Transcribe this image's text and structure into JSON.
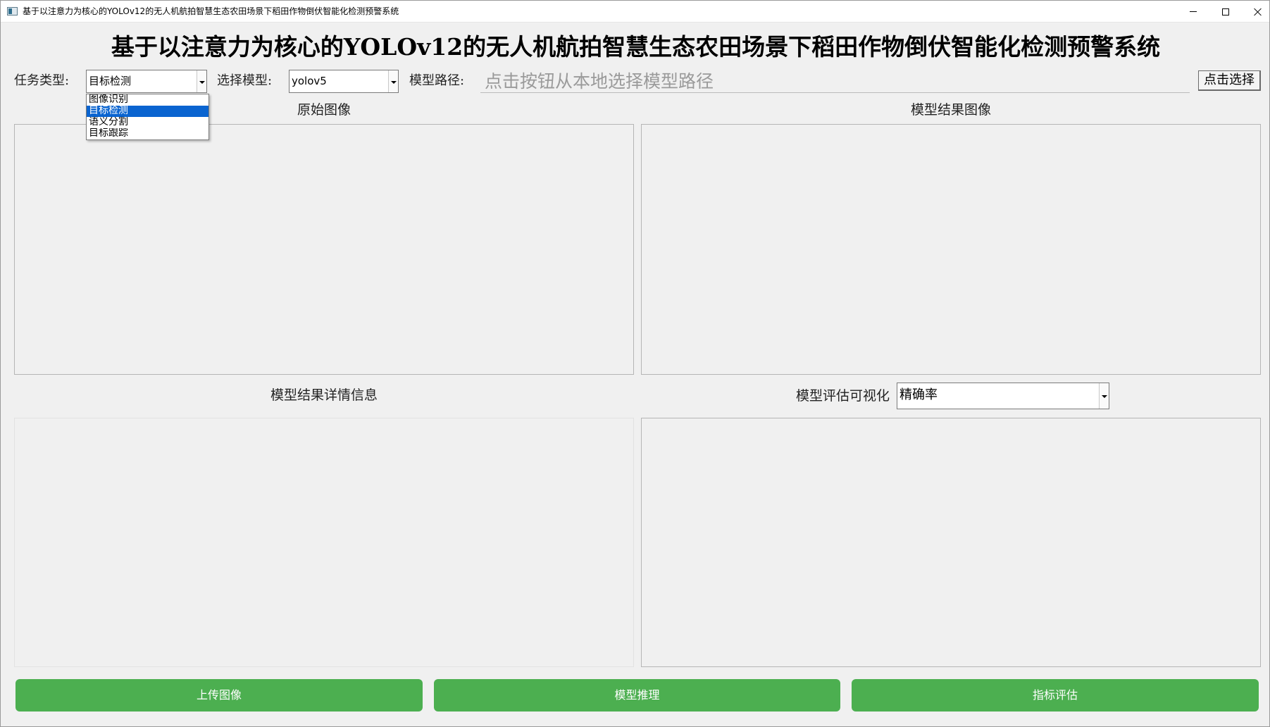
{
  "window": {
    "title": "基于以注意力为核心的YOLOv12的无人机航拍智慧生态农田场景下稻田作物倒伏智能化检测预警系统"
  },
  "header": {
    "title": "基于以注意力为核心的YOLOv12的无人机航拍智慧生态农田场景下稻田作物倒伏智能化检测预警系统"
  },
  "controls": {
    "task_type_label": "任务类型:",
    "task_type_value": "目标检测",
    "task_type_options": [
      "图像识别",
      "目标检测",
      "语义分割",
      "目标跟踪"
    ],
    "task_type_selected_index": 1,
    "model_label": "选择模型:",
    "model_value": "yolov5",
    "model_path_label": "模型路径:",
    "model_path_value": "",
    "model_path_placeholder": "点击按钮从本地选择模型路径",
    "select_button": "点击选择"
  },
  "panels": {
    "original_image_label": "原始图像",
    "result_image_label": "模型结果图像",
    "detail_info_label": "模型结果详情信息",
    "eval_viz_label": "模型评估可视化",
    "eval_metric_value": "精确率"
  },
  "actions": {
    "upload": "上传图像",
    "infer": "模型推理",
    "evaluate": "指标评估"
  },
  "colors": {
    "action_button": "#4caf50",
    "selection_highlight": "#0a64d0",
    "window_background": "#f0f0f0"
  },
  "icons": {
    "app": "app-icon",
    "minimize": "minimize-icon",
    "maximize": "maximize-icon",
    "close": "close-icon",
    "combo_arrow": "chevron-down-icon"
  }
}
